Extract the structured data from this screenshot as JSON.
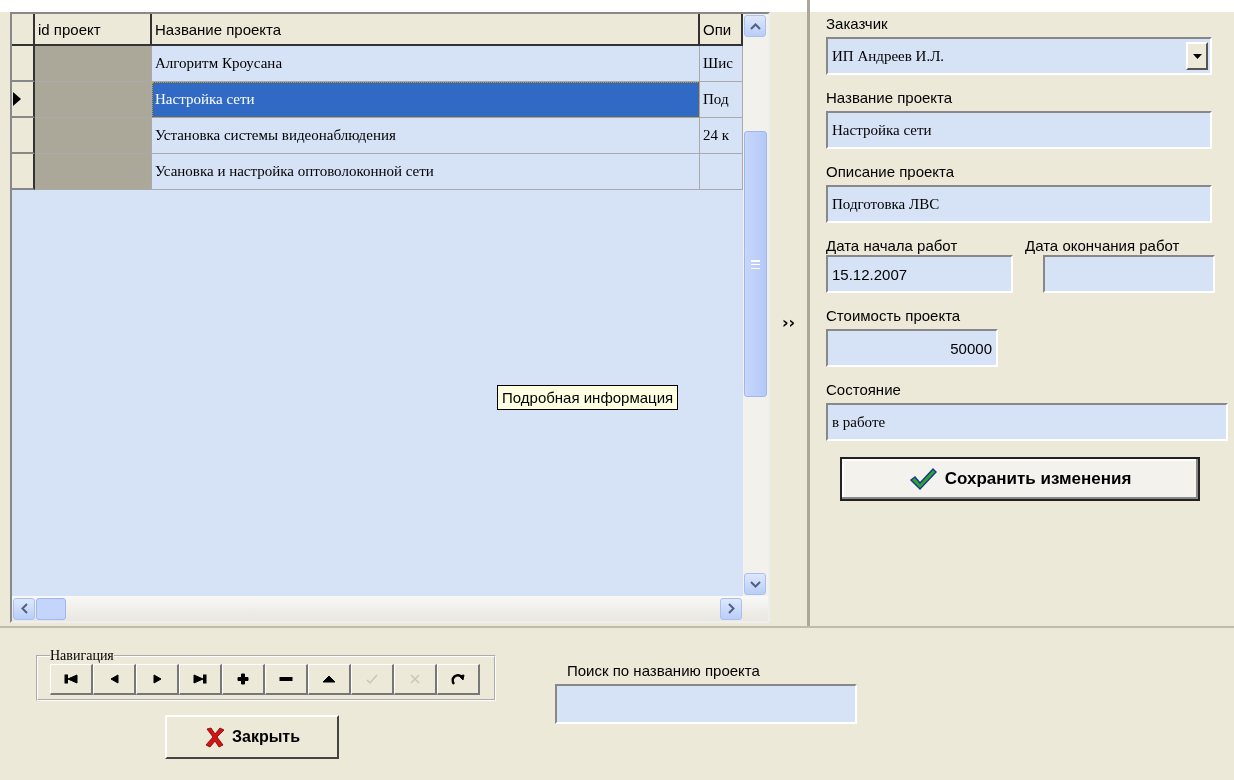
{
  "grid": {
    "columns": [
      "id проект",
      "Название проекта",
      "Опи"
    ],
    "rows": [
      {
        "name": "Алгоритм Кроусана",
        "description": "Шис",
        "selected": false
      },
      {
        "name": "Настройка сети",
        "description": "Под",
        "selected": true
      },
      {
        "name": "Установка системы видеонаблюдения",
        "description": "24 к",
        "selected": false
      },
      {
        "name": "Усановка и настройка оптоволоконной сети",
        "selected": false
      }
    ]
  },
  "tooltip": "Подробная информация",
  "splitter": {
    "label": "››"
  },
  "details": {
    "customer": {
      "label": "Заказчик",
      "value": "ИП Андреев И.Л."
    },
    "title": {
      "label": "Название проекта",
      "value": "Настройка сети"
    },
    "description": {
      "label": "Описание проекта",
      "value": "Подготовка ЛВС"
    },
    "start_date": {
      "label": "Дата начала работ",
      "value": "15.12.2007"
    },
    "end_date": {
      "label": "Дата окончания работ"
    },
    "cost": {
      "label": "Стоимость проекта",
      "value": "50000"
    },
    "state": {
      "label": "Состояние",
      "value": "в работе"
    },
    "save_button": "Сохранить изменения"
  },
  "navigator": {
    "title": "Навигация",
    "buttons": [
      {
        "kind": "first",
        "disabled": false
      },
      {
        "kind": "prior",
        "disabled": false
      },
      {
        "kind": "next",
        "disabled": false
      },
      {
        "kind": "last",
        "disabled": false
      },
      {
        "kind": "insert",
        "disabled": false
      },
      {
        "kind": "delete",
        "disabled": false
      },
      {
        "kind": "edit",
        "disabled": false
      },
      {
        "kind": "post",
        "disabled": true
      },
      {
        "kind": "cancel",
        "disabled": true
      },
      {
        "kind": "refresh",
        "disabled": false
      }
    ]
  },
  "search": {
    "label": "Поиск по названию проекта"
  },
  "close_button": "Закрыть"
}
